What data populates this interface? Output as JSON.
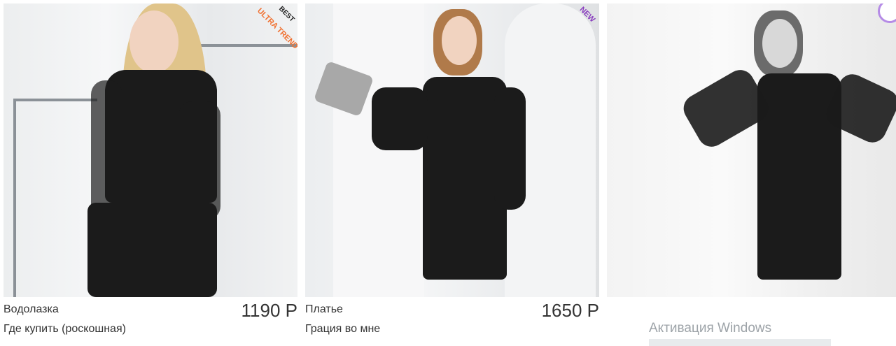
{
  "products": [
    {
      "name": "Водолазка",
      "subtitle": "Где купить (роскошная)",
      "price": "1190 Р",
      "badge_line1": "BEST",
      "badge_line2": "ULTRA TREND"
    },
    {
      "name": "Платье",
      "subtitle": "Грация во мне",
      "price": "1650 Р",
      "badge_line1": "NEW"
    },
    {
      "overlay_text": "Активация Windows"
    }
  ],
  "colors": {
    "badge_orange": "#f07030",
    "badge_purple": "#8a3fbf",
    "price_text": "#333333"
  }
}
